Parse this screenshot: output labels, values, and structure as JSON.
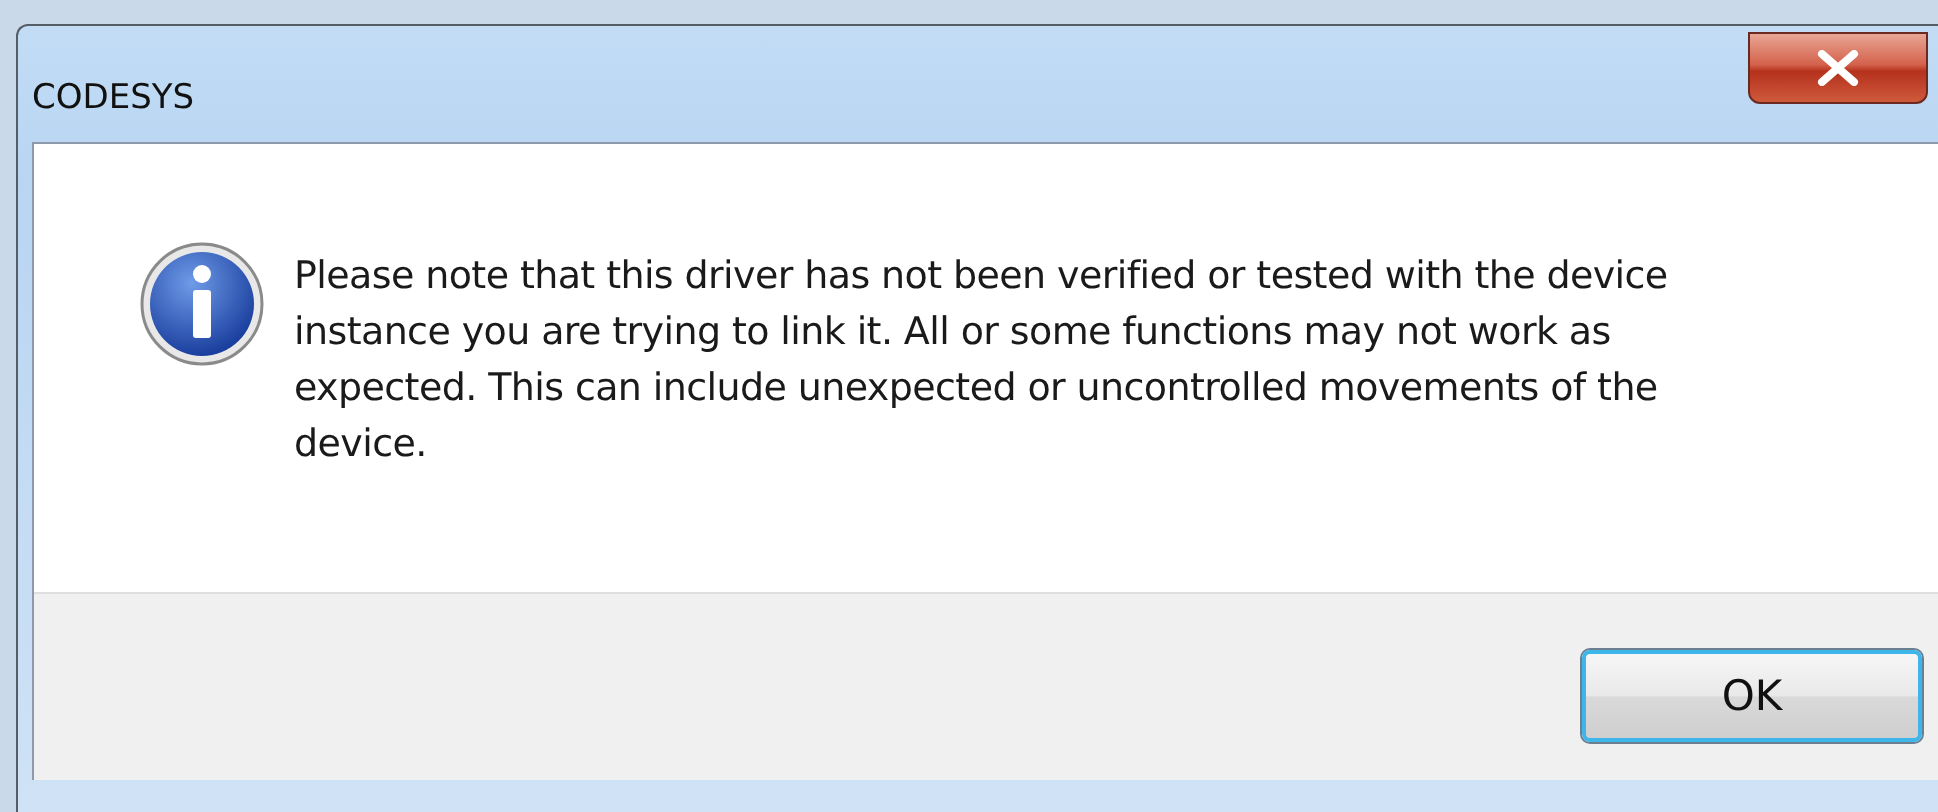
{
  "window": {
    "title": "CODESYS"
  },
  "message": "Please note that this driver has not been verified or tested with the device instance you are trying to link it. All or some functions may not work as expected. This can include unexpected or uncontrolled movements of the device.",
  "buttons": [
    {
      "label": "OK",
      "focused": true
    }
  ]
}
